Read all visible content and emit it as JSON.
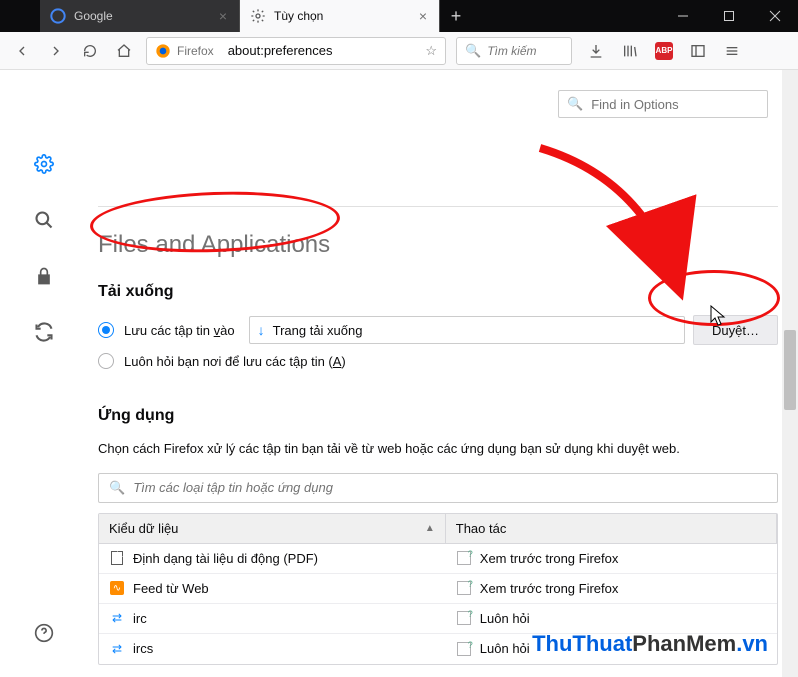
{
  "tabs": [
    {
      "label": "Google"
    },
    {
      "label": "Tùy chọn"
    }
  ],
  "urlbar": {
    "identity": "Firefox",
    "value": "about:preferences"
  },
  "searchbar": {
    "placeholder": "Tìm kiếm"
  },
  "find_in_options": {
    "placeholder": "Find in Options"
  },
  "section": {
    "title": "Files and Applications",
    "downloads": {
      "heading": "Tải xuống",
      "save_to_label_pre": "Lưu các tập tin ",
      "save_to_key": "v",
      "save_to_label_post": "ào",
      "path_text": "Trang tải xuống",
      "browse_label": "Duyệt…",
      "ask_label_pre": "Luôn hỏi bạn nơi để lưu các tập tin (",
      "ask_key": "A",
      "ask_label_post": ")"
    },
    "apps": {
      "heading": "Ứng dụng",
      "description": "Chọn cách Firefox xử lý các tập tin bạn tải về từ web hoặc các ứng dụng bạn sử dụng khi duyệt web.",
      "filter_placeholder": "Tìm các loại tập tin hoặc ứng dụng",
      "col_type": "Kiểu dữ liệu",
      "col_action": "Thao tác",
      "rows": [
        {
          "type": "Định dạng tài liệu di động (PDF)",
          "action": "Xem trước trong Firefox"
        },
        {
          "type": "Feed từ Web",
          "action": "Xem trước trong Firefox"
        },
        {
          "type": "irc",
          "action": "Luôn hỏi"
        },
        {
          "type": "ircs",
          "action": "Luôn hỏi"
        }
      ]
    }
  },
  "watermark": {
    "a": "ThuThuat",
    "b": "PhanMem",
    "c": ".vn"
  }
}
